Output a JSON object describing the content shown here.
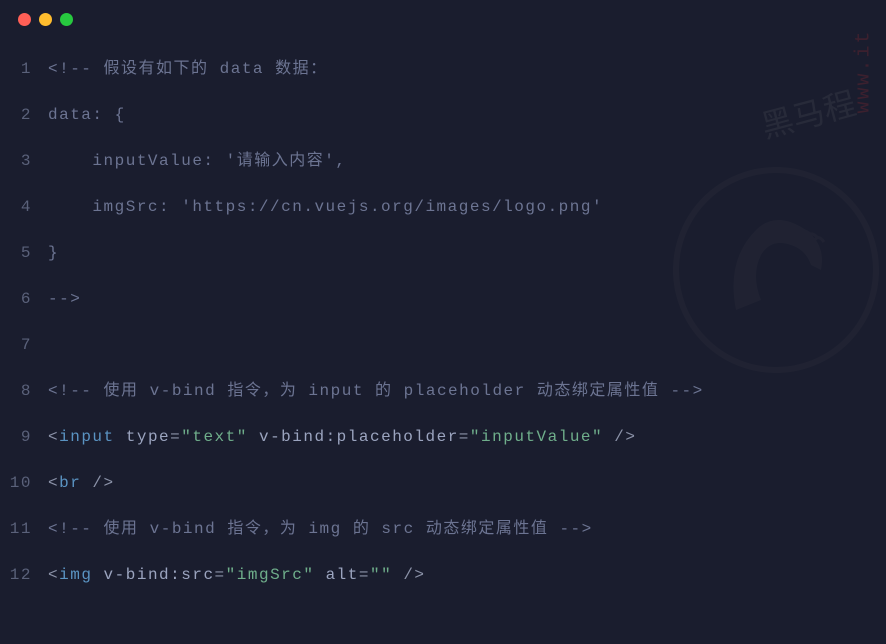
{
  "titleBar": {
    "buttons": [
      "close",
      "minimize",
      "maximize"
    ]
  },
  "code": {
    "lines": [
      {
        "num": "1",
        "segments": [
          {
            "cls": "comment",
            "text": "<!-- 假设有如下的 data 数据："
          }
        ]
      },
      {
        "num": "2",
        "segments": [
          {
            "cls": "comment",
            "text": "data: {"
          }
        ]
      },
      {
        "num": "3",
        "segments": [
          {
            "cls": "comment",
            "text": "    inputValue: '请输入内容',"
          }
        ]
      },
      {
        "num": "4",
        "segments": [
          {
            "cls": "comment",
            "text": "    imgSrc: 'https://cn.vuejs.org/images/logo.png'"
          }
        ]
      },
      {
        "num": "5",
        "segments": [
          {
            "cls": "comment",
            "text": "}"
          }
        ]
      },
      {
        "num": "6",
        "segments": [
          {
            "cls": "comment",
            "text": "-->"
          }
        ]
      },
      {
        "num": "7",
        "segments": [
          {
            "cls": "",
            "text": ""
          }
        ]
      },
      {
        "num": "8",
        "segments": [
          {
            "cls": "comment",
            "text": "<!-- 使用 v-bind 指令，为 input 的 placeholder 动态绑定属性值 -->"
          }
        ]
      },
      {
        "num": "9",
        "segments": [
          {
            "cls": "punct",
            "text": "<"
          },
          {
            "cls": "tag",
            "text": "input"
          },
          {
            "cls": "",
            "text": " "
          },
          {
            "cls": "attr-name",
            "text": "type"
          },
          {
            "cls": "punct",
            "text": "="
          },
          {
            "cls": "string",
            "text": "\"text\""
          },
          {
            "cls": "",
            "text": " "
          },
          {
            "cls": "attr-name",
            "text": "v-bind:placeholder"
          },
          {
            "cls": "punct",
            "text": "="
          },
          {
            "cls": "string",
            "text": "\"inputValue\""
          },
          {
            "cls": "",
            "text": " "
          },
          {
            "cls": "punct",
            "text": "/>"
          }
        ]
      },
      {
        "num": "10",
        "segments": [
          {
            "cls": "punct",
            "text": "<"
          },
          {
            "cls": "tag",
            "text": "br"
          },
          {
            "cls": "",
            "text": " "
          },
          {
            "cls": "punct",
            "text": "/>"
          }
        ]
      },
      {
        "num": "11",
        "segments": [
          {
            "cls": "comment",
            "text": "<!-- 使用 v-bind 指令，为 img 的 src 动态绑定属性值 -->"
          }
        ]
      },
      {
        "num": "12",
        "segments": [
          {
            "cls": "punct",
            "text": "<"
          },
          {
            "cls": "tag",
            "text": "img"
          },
          {
            "cls": "",
            "text": " "
          },
          {
            "cls": "attr-name",
            "text": "v-bind:src"
          },
          {
            "cls": "punct",
            "text": "="
          },
          {
            "cls": "string",
            "text": "\"imgSrc\""
          },
          {
            "cls": "",
            "text": " "
          },
          {
            "cls": "attr-name",
            "text": "alt"
          },
          {
            "cls": "punct",
            "text": "="
          },
          {
            "cls": "string",
            "text": "\"\""
          },
          {
            "cls": "",
            "text": " "
          },
          {
            "cls": "punct",
            "text": "/>"
          }
        ]
      }
    ]
  },
  "watermark": {
    "cn": "黑马程",
    "url": "www.it"
  }
}
